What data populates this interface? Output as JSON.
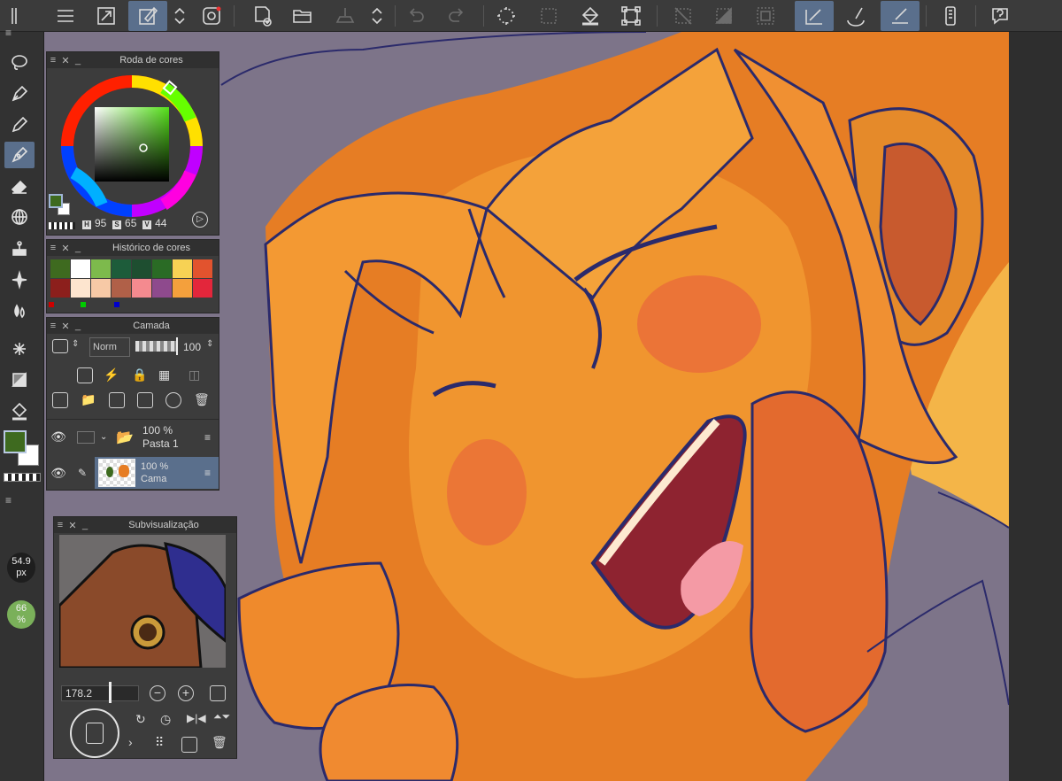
{
  "color_wheel": {
    "title": "Roda de cores",
    "h": "95",
    "s": "65",
    "v": "44",
    "h_label": "H",
    "s_label": "S",
    "v_label": "V",
    "main_color": "#3e6a1f",
    "sub_color": "#ffffff"
  },
  "color_history": {
    "title": "Histórico de cores",
    "colors": [
      "#3e6a1f",
      "#ffffff",
      "#7dba4c",
      "#1d5c3a",
      "#1e4e30",
      "#2a6b25",
      "#f7d254",
      "#e2532e",
      "#8c1f1c",
      "#fde5cf",
      "#f7c9a6",
      "#b06048",
      "#f48a8f",
      "#8e4a8d",
      "#f4a03c",
      "#e3263b"
    ]
  },
  "layer": {
    "title": "Camada",
    "blend_mode": "Norm",
    "opacity_value": "100",
    "folder": {
      "opacity": "100 %",
      "name": "Pasta 1"
    },
    "layer1": {
      "opacity": "100 %",
      "name": "Cama"
    }
  },
  "navigator": {
    "title": "Subvisualização",
    "zoom": "178.2"
  },
  "brush_size": {
    "value": "54.9",
    "unit": "px"
  },
  "brush_opacity": {
    "value": "66",
    "unit": "%"
  },
  "colors": {
    "toolbar_active": "#5a6f8c",
    "canvas_bg": "#7d7489",
    "main_color": "#3e6a1f",
    "line_art": "#2b2a6b"
  }
}
